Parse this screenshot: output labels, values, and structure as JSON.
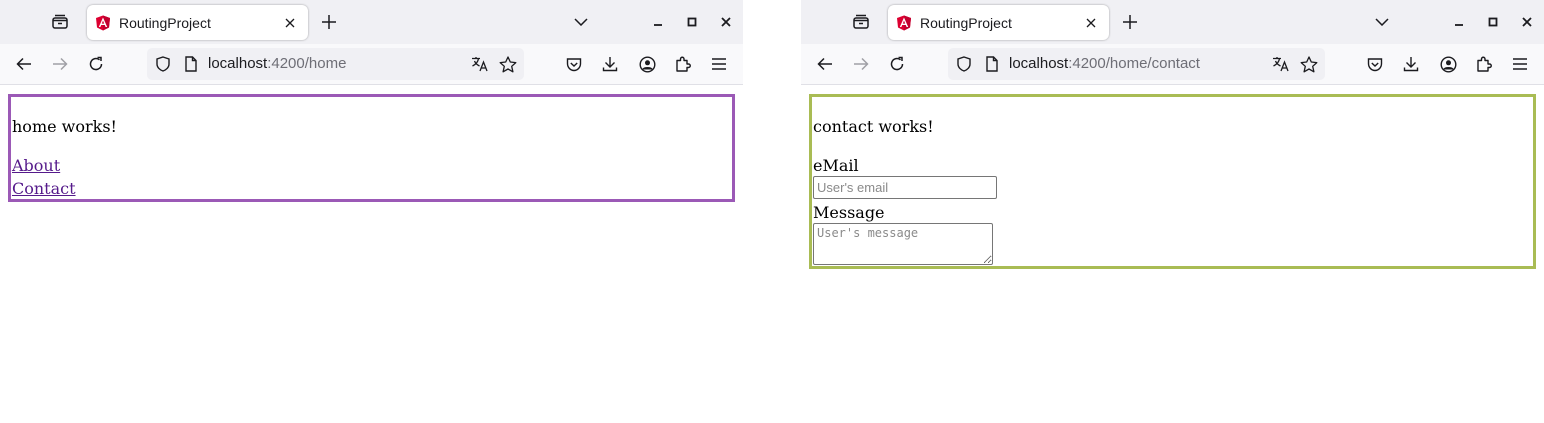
{
  "windows": [
    {
      "tab": {
        "title": "RoutingProject"
      },
      "url": {
        "host": "localhost",
        "path": ":4200/home"
      },
      "page": {
        "heading": "home works!",
        "links": [
          "About",
          "Contact"
        ],
        "border_color": "#9b59b6"
      }
    },
    {
      "tab": {
        "title": "RoutingProject"
      },
      "url": {
        "host": "localhost",
        "path": ":4200/home/contact"
      },
      "page": {
        "heading": "contact works!",
        "email_label": "eMail",
        "email_placeholder": "User's email",
        "email_value": "",
        "message_label": "Message",
        "message_placeholder": "User's message",
        "message_value": "",
        "border_color": "#a9bc54"
      }
    }
  ],
  "icons": {
    "favicon": "angular-logo-icon",
    "tab_list": "tab-list-icon",
    "close": "close-icon",
    "new_tab": "plus-icon",
    "tab_menu": "chevron-down-icon",
    "back": "back-arrow-icon",
    "forward": "forward-arrow-icon",
    "reload": "reload-icon",
    "shield": "shield-icon",
    "page": "page-icon",
    "translate": "translate-icon",
    "bookmark": "star-icon",
    "pocket": "pocket-icon",
    "downloads": "download-icon",
    "account": "account-icon",
    "extensions": "puzzle-icon",
    "menu": "hamburger-menu-icon"
  }
}
